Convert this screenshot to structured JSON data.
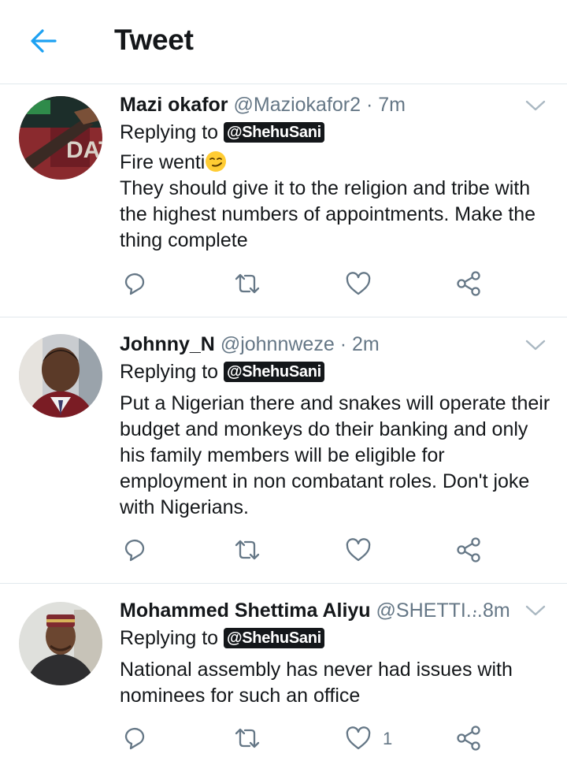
{
  "header": {
    "title": "Tweet",
    "back_icon": "arrow-left-icon",
    "accent": "#1da1f2"
  },
  "tweets": [
    {
      "name": "Mazi okafor",
      "handle": "@Maziokafor2",
      "separator": "·",
      "time": "7m",
      "replying_prefix": "Replying to",
      "mention": "@ShehuSani",
      "lines": [
        "Fire wenti",
        "They should give it to the religion and tribe with the highest numbers of appointments. Make the thing complete"
      ],
      "likes": ""
    },
    {
      "name": "Johnny_N",
      "handle": "@johnnweze",
      "separator": "·",
      "time": "2m",
      "replying_prefix": "Replying to",
      "mention": "@ShehuSani",
      "lines": [
        "Put a Nigerian there and snakes will operate their budget and monkeys do their banking and only his family members will be eligible for employment in non combatant roles. Don't joke with Nigerians."
      ],
      "likes": ""
    },
    {
      "name": "Mohammed Shettima Aliyu",
      "handle": "@SHETTI...",
      "separator": "·",
      "time": "8m",
      "replying_prefix": "Replying to",
      "mention": "@ShehuSani",
      "lines": [
        "National assembly has never had issues with nominees for such an office"
      ],
      "likes": "1"
    }
  ]
}
